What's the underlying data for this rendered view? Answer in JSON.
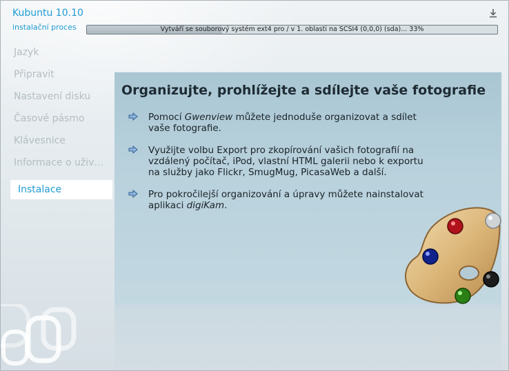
{
  "window": {
    "title": "Kubuntu 10.10",
    "subtitle": "instalační proces"
  },
  "progress": {
    "text": "Vytváří se souborový systém ext4 pro / v 1. oblasti na SCSI4 (0,0,0) (sda)... 33%",
    "percent": 33
  },
  "sidebar": {
    "steps": [
      {
        "label": "Jazyk",
        "state": "done"
      },
      {
        "label": "Připravit",
        "state": "done"
      },
      {
        "label": "Nastavení disku",
        "state": "done"
      },
      {
        "label": "Časové pásmo",
        "state": "done"
      },
      {
        "label": "Klávesnice",
        "state": "done"
      },
      {
        "label": "Informace o uživ…",
        "state": "done"
      },
      {
        "label": "Instalace",
        "state": "active"
      }
    ]
  },
  "slide": {
    "title": "Organizujte, prohlížejte a sdílejte vaše fotografie",
    "bullets": [
      {
        "pre": "Pomocí ",
        "em": "Gwenview",
        "post": " můžete jednoduše organizovat a sdílet vaše fotografie."
      },
      {
        "pre": "Využijte volbu Export pro zkopírování vašich fotografií na vzdálený počítač, iPod, vlastní HTML galerii nebo k exportu na služby jako Flickr, SmugMug, PicasaWeb a další.",
        "em": "",
        "post": ""
      },
      {
        "pre": "Pro pokročilejší organizování a úpravy můžete nainstalovat aplikaci ",
        "em": "digiKam",
        "post": "."
      }
    ]
  },
  "icons": {
    "download": "download-icon",
    "bullet": "arrow-right-icon",
    "palette": "paint-palette-icon",
    "logo": "kde-logo-icon"
  },
  "colors": {
    "accent": "#1f9bd4",
    "inactive_step": "#b4bdc3",
    "slide_bg": "#b8d1dc"
  }
}
